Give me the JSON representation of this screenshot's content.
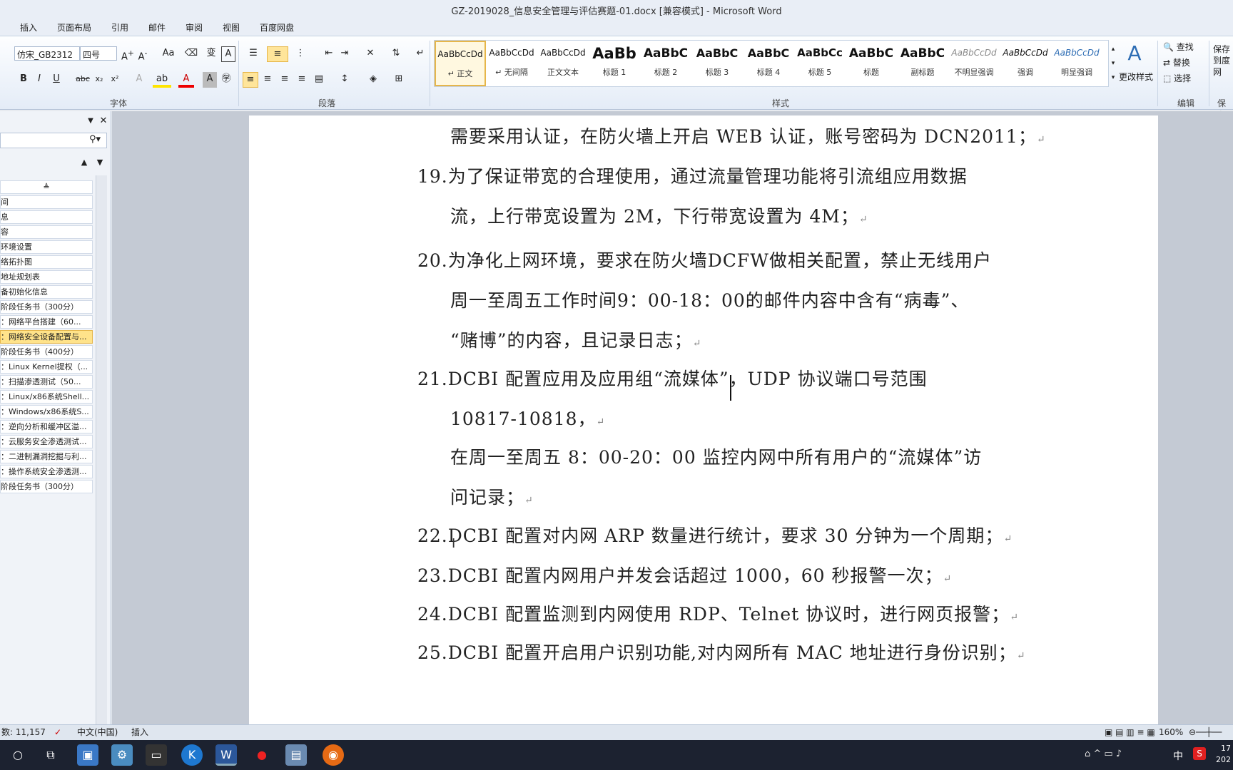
{
  "window": {
    "title": "GZ-2019028_信息安全管理与评估赛题-01.docx [兼容模式] - Microsoft Word"
  },
  "tabs": [
    "插入",
    "页面布局",
    "引用",
    "邮件",
    "审阅",
    "视图",
    "百度网盘"
  ],
  "ribbon": {
    "font_name": "仿宋_GB2312",
    "font_size": "四号",
    "group_font": "字体",
    "group_paragraph": "段落",
    "group_styles": "样式",
    "group_edit": "编辑",
    "group_save": "保存",
    "change_styles": "更改样式",
    "find": "查找",
    "replace": "替换",
    "select": "选择",
    "save_to": "保存到度网"
  },
  "styles": [
    {
      "preview": "AaBbCcDd",
      "name": "↵ 正文"
    },
    {
      "preview": "AaBbCcDd",
      "name": "↵ 无间隔"
    },
    {
      "preview": "AaBbCcDd",
      "name": "正文文本"
    },
    {
      "preview": "AaBb",
      "name": "标题 1"
    },
    {
      "preview": "AaBbC",
      "name": "标题 2"
    },
    {
      "preview": "AaBbC",
      "name": "标题 3"
    },
    {
      "preview": "AaBbC",
      "name": "标题 4"
    },
    {
      "preview": "AaBbCc",
      "name": "标题 5"
    },
    {
      "preview": "AaBbC",
      "name": "标题"
    },
    {
      "preview": "AaBbC",
      "name": "副标题"
    },
    {
      "preview": "AaBbCcDd",
      "name": "不明显强调"
    },
    {
      "preview": "AaBbCcDd",
      "name": "强调"
    },
    {
      "preview": "AaBbCcDd",
      "name": "明显强调"
    }
  ],
  "nav": {
    "items": [
      "间",
      "息",
      "容",
      "环境设置",
      "络拓扑图",
      "地址规划表",
      "备初始化信息",
      "阶段任务书（300分）",
      "：网络平台搭建（60...",
      "：网络安全设备配置与...",
      "阶段任务书（400分）",
      "：Linux Kernel提权（...",
      "：扫描渗透测试（50...",
      "：Linux/x86系统Shell...",
      "：Windows/x86系统S...",
      "：逆向分析和缓冲区溢...",
      "：云服务安全渗透测试...",
      "：二进制漏洞挖掘与利...",
      "：操作系统安全渗透测...",
      "阶段任务书（300分）"
    ]
  },
  "document": {
    "lines": [
      "需要采用认证，在防火墙上开启 WEB 认证，账号密码为 DCN2011；",
      "19.为了保证带宽的合理使用，通过流量管理功能将引流组应用数据",
      "流，上行带宽设置为 2M，下行带宽设置为 4M；",
      "20.为净化上网环境，要求在防火墙DCFW做相关配置，禁止无线用户",
      "周一至周五工作时间9：00-18：00的邮件内容中含有“病毒”、",
      "“赌博”的内容，且记录日志；",
      "21.DCBI 配置应用及应用组“流媒体”，UDP 协议端口号范围",
      "10817-10818，",
      "在周一至周五 8：00-20：00 监控内网中所有用户的“流媒体”访",
      "问记录；",
      "22.DCBI 配置对内网 ARP 数量进行统计，要求 30 分钟为一个周期；",
      "23.DCBI 配置内网用户并发会话超过 1000，60 秒报警一次；",
      "24.DCBI 配置监测到内网使用 RDP、Telnet 协议时，进行网页报警；",
      "25.DCBI 配置开启用户识别功能,对内网所有 MAC 地址进行身份识别；"
    ],
    "para_mark": "↵"
  },
  "status": {
    "word_count": "数: 11,157",
    "language": "中文(中国)",
    "mode": "插入",
    "zoom": "160%"
  },
  "tray": {
    "ime": "中",
    "app": "S",
    "time": "17",
    "date": "202"
  }
}
